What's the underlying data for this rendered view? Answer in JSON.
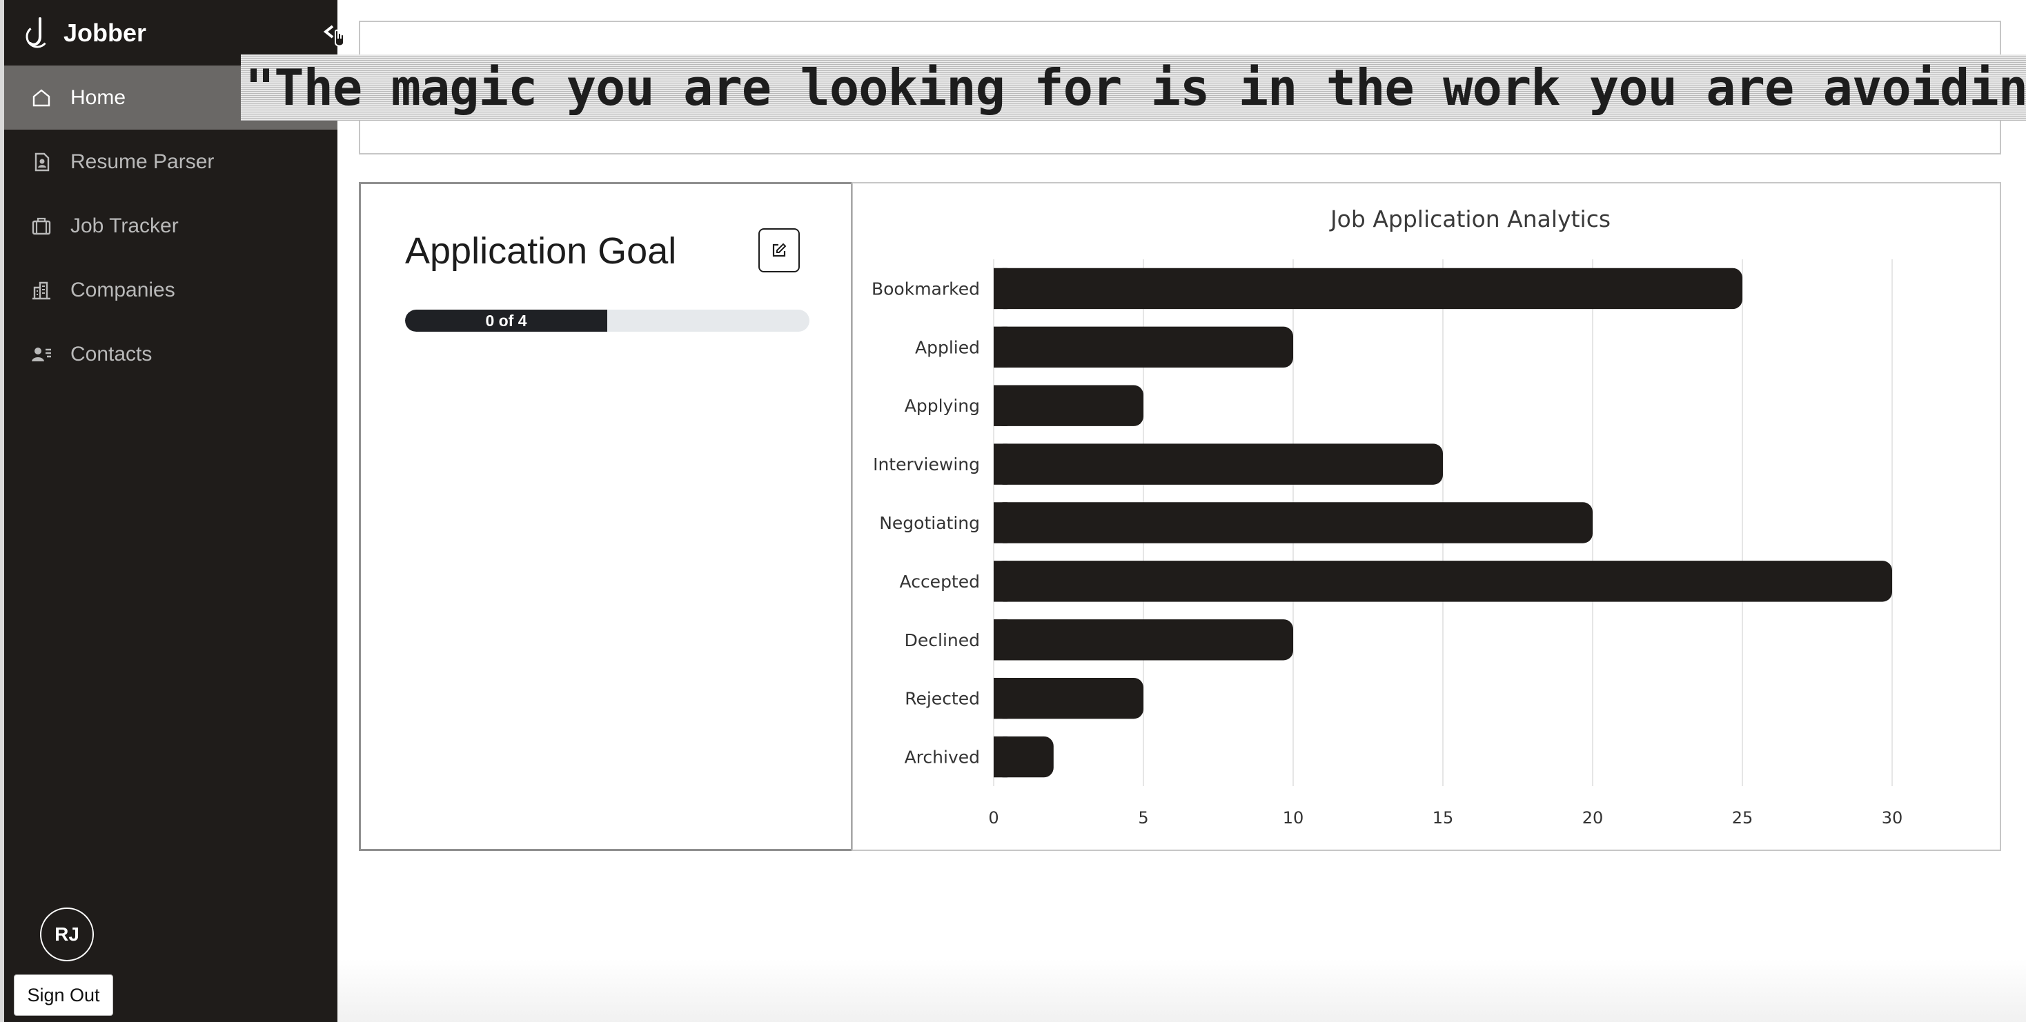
{
  "app": {
    "name": "Jobber"
  },
  "sidebar": {
    "items": [
      {
        "label": "Home",
        "icon": "home-icon",
        "active": true
      },
      {
        "label": "Resume Parser",
        "icon": "resume-icon",
        "active": false
      },
      {
        "label": "Job Tracker",
        "icon": "briefcase-icon",
        "active": false
      },
      {
        "label": "Companies",
        "icon": "building-icon",
        "active": false
      },
      {
        "label": "Contacts",
        "icon": "contacts-icon",
        "active": false
      }
    ],
    "user_initials": "RJ",
    "sign_out_label": "Sign Out"
  },
  "quote": {
    "text": "\"The magic you are looking for is in the work you are avoiding.\""
  },
  "goal": {
    "title": "Application Goal",
    "progress_label": "0 of 4",
    "progress_fraction": 0.5
  },
  "colors": {
    "sidebar_bg": "#1f1c1a",
    "active_item_bg": "#6a6866",
    "bar": "#1f1c1a"
  },
  "chart_data": {
    "type": "bar",
    "orientation": "horizontal",
    "title": "Job Application Analytics",
    "categories": [
      "Bookmarked",
      "Applied",
      "Applying",
      "Interviewing",
      "Negotiating",
      "Accepted",
      "Declined",
      "Rejected",
      "Archived"
    ],
    "values": [
      25,
      10,
      5,
      15,
      20,
      30,
      10,
      5,
      2
    ],
    "xlim": [
      0,
      30
    ],
    "xticks": [
      0,
      5,
      10,
      15,
      20,
      25,
      30
    ],
    "grid": true
  }
}
